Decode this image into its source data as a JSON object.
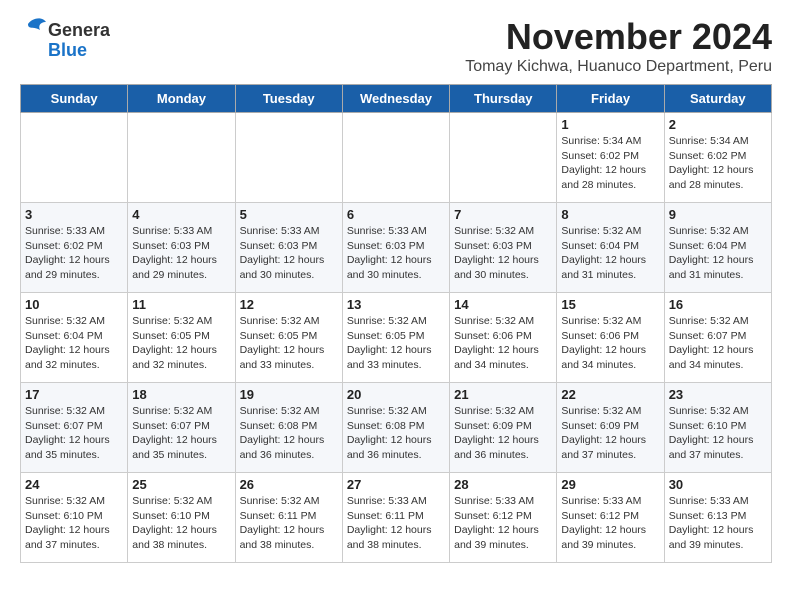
{
  "header": {
    "logo_general": "General",
    "logo_blue": "Blue",
    "month_title": "November 2024",
    "location": "Tomay Kichwa, Huanuco Department, Peru"
  },
  "days_of_week": [
    "Sunday",
    "Monday",
    "Tuesday",
    "Wednesday",
    "Thursday",
    "Friday",
    "Saturday"
  ],
  "weeks": [
    [
      {
        "day": "",
        "info": ""
      },
      {
        "day": "",
        "info": ""
      },
      {
        "day": "",
        "info": ""
      },
      {
        "day": "",
        "info": ""
      },
      {
        "day": "",
        "info": ""
      },
      {
        "day": "1",
        "info": "Sunrise: 5:34 AM\nSunset: 6:02 PM\nDaylight: 12 hours and 28 minutes."
      },
      {
        "day": "2",
        "info": "Sunrise: 5:34 AM\nSunset: 6:02 PM\nDaylight: 12 hours and 28 minutes."
      }
    ],
    [
      {
        "day": "3",
        "info": "Sunrise: 5:33 AM\nSunset: 6:02 PM\nDaylight: 12 hours and 29 minutes."
      },
      {
        "day": "4",
        "info": "Sunrise: 5:33 AM\nSunset: 6:03 PM\nDaylight: 12 hours and 29 minutes."
      },
      {
        "day": "5",
        "info": "Sunrise: 5:33 AM\nSunset: 6:03 PM\nDaylight: 12 hours and 30 minutes."
      },
      {
        "day": "6",
        "info": "Sunrise: 5:33 AM\nSunset: 6:03 PM\nDaylight: 12 hours and 30 minutes."
      },
      {
        "day": "7",
        "info": "Sunrise: 5:32 AM\nSunset: 6:03 PM\nDaylight: 12 hours and 30 minutes."
      },
      {
        "day": "8",
        "info": "Sunrise: 5:32 AM\nSunset: 6:04 PM\nDaylight: 12 hours and 31 minutes."
      },
      {
        "day": "9",
        "info": "Sunrise: 5:32 AM\nSunset: 6:04 PM\nDaylight: 12 hours and 31 minutes."
      }
    ],
    [
      {
        "day": "10",
        "info": "Sunrise: 5:32 AM\nSunset: 6:04 PM\nDaylight: 12 hours and 32 minutes."
      },
      {
        "day": "11",
        "info": "Sunrise: 5:32 AM\nSunset: 6:05 PM\nDaylight: 12 hours and 32 minutes."
      },
      {
        "day": "12",
        "info": "Sunrise: 5:32 AM\nSunset: 6:05 PM\nDaylight: 12 hours and 33 minutes."
      },
      {
        "day": "13",
        "info": "Sunrise: 5:32 AM\nSunset: 6:05 PM\nDaylight: 12 hours and 33 minutes."
      },
      {
        "day": "14",
        "info": "Sunrise: 5:32 AM\nSunset: 6:06 PM\nDaylight: 12 hours and 34 minutes."
      },
      {
        "day": "15",
        "info": "Sunrise: 5:32 AM\nSunset: 6:06 PM\nDaylight: 12 hours and 34 minutes."
      },
      {
        "day": "16",
        "info": "Sunrise: 5:32 AM\nSunset: 6:07 PM\nDaylight: 12 hours and 34 minutes."
      }
    ],
    [
      {
        "day": "17",
        "info": "Sunrise: 5:32 AM\nSunset: 6:07 PM\nDaylight: 12 hours and 35 minutes."
      },
      {
        "day": "18",
        "info": "Sunrise: 5:32 AM\nSunset: 6:07 PM\nDaylight: 12 hours and 35 minutes."
      },
      {
        "day": "19",
        "info": "Sunrise: 5:32 AM\nSunset: 6:08 PM\nDaylight: 12 hours and 36 minutes."
      },
      {
        "day": "20",
        "info": "Sunrise: 5:32 AM\nSunset: 6:08 PM\nDaylight: 12 hours and 36 minutes."
      },
      {
        "day": "21",
        "info": "Sunrise: 5:32 AM\nSunset: 6:09 PM\nDaylight: 12 hours and 36 minutes."
      },
      {
        "day": "22",
        "info": "Sunrise: 5:32 AM\nSunset: 6:09 PM\nDaylight: 12 hours and 37 minutes."
      },
      {
        "day": "23",
        "info": "Sunrise: 5:32 AM\nSunset: 6:10 PM\nDaylight: 12 hours and 37 minutes."
      }
    ],
    [
      {
        "day": "24",
        "info": "Sunrise: 5:32 AM\nSunset: 6:10 PM\nDaylight: 12 hours and 37 minutes."
      },
      {
        "day": "25",
        "info": "Sunrise: 5:32 AM\nSunset: 6:10 PM\nDaylight: 12 hours and 38 minutes."
      },
      {
        "day": "26",
        "info": "Sunrise: 5:32 AM\nSunset: 6:11 PM\nDaylight: 12 hours and 38 minutes."
      },
      {
        "day": "27",
        "info": "Sunrise: 5:33 AM\nSunset: 6:11 PM\nDaylight: 12 hours and 38 minutes."
      },
      {
        "day": "28",
        "info": "Sunrise: 5:33 AM\nSunset: 6:12 PM\nDaylight: 12 hours and 39 minutes."
      },
      {
        "day": "29",
        "info": "Sunrise: 5:33 AM\nSunset: 6:12 PM\nDaylight: 12 hours and 39 minutes."
      },
      {
        "day": "30",
        "info": "Sunrise: 5:33 AM\nSunset: 6:13 PM\nDaylight: 12 hours and 39 minutes."
      }
    ]
  ]
}
